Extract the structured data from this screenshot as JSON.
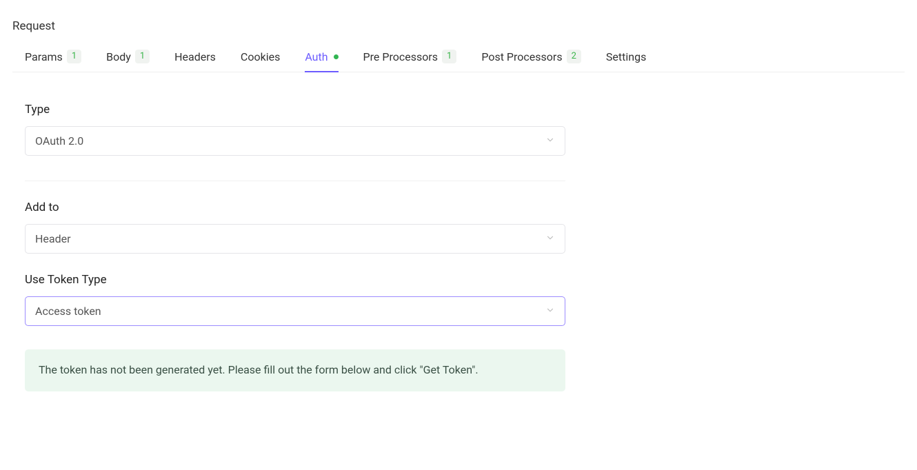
{
  "section_title": "Request",
  "tabs": {
    "params": {
      "label": "Params",
      "count": "1"
    },
    "body": {
      "label": "Body",
      "count": "1"
    },
    "headers": {
      "label": "Headers"
    },
    "cookies": {
      "label": "Cookies"
    },
    "auth": {
      "label": "Auth"
    },
    "pre": {
      "label": "Pre Processors",
      "count": "1"
    },
    "post": {
      "label": "Post Processors",
      "count": "2"
    },
    "settings": {
      "label": "Settings"
    }
  },
  "form": {
    "type_label": "Type",
    "type_value": "OAuth 2.0",
    "addto_label": "Add to",
    "addto_value": "Header",
    "token_label": "Use Token Type",
    "token_value": "Access token"
  },
  "info": "The token has not been generated yet. Please fill out the form below and click \"Get Token\"."
}
